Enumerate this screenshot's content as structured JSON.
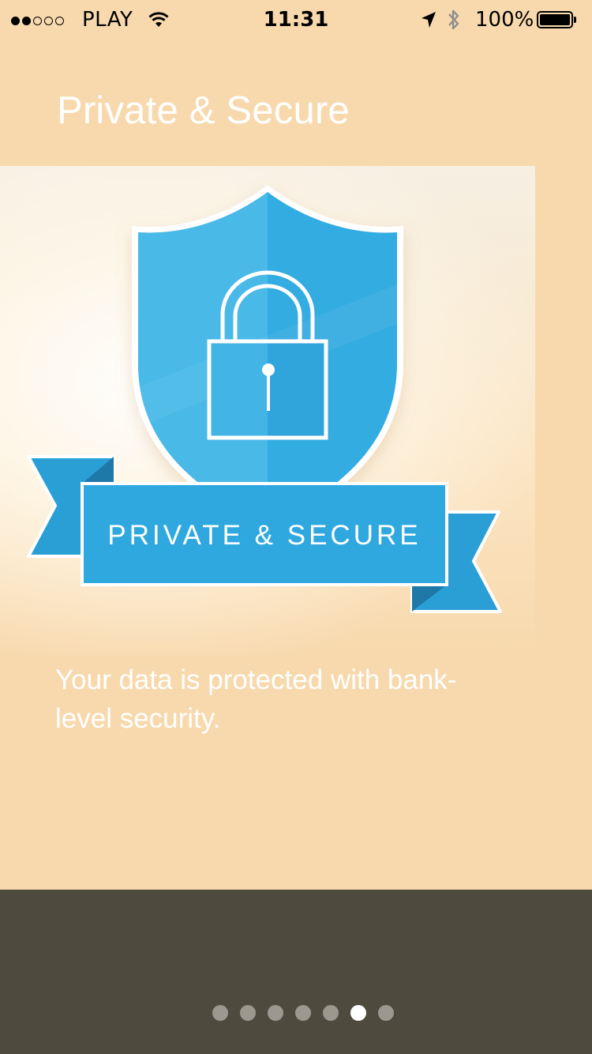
{
  "status_bar": {
    "signal_bars_on": 2,
    "signal_bars_total": 5,
    "carrier": "PLAY",
    "time": "11:31",
    "battery_percent": "100%",
    "icons": [
      "wifi-icon",
      "location-arrow-icon",
      "bluetooth-icon",
      "battery-icon"
    ]
  },
  "onboarding": {
    "title": "Private & Secure",
    "illustration": {
      "icons": [
        "shield-icon",
        "padlock-icon",
        "ribbon-banner"
      ],
      "banner_text": "PRIVATE & SECURE"
    },
    "description": "Your data is protected with bank-level security."
  },
  "pager": {
    "count": 7,
    "active_index": 5
  },
  "colors": {
    "background": "#f8d9ad",
    "shield_blue": "#2fa8df",
    "bottom_bar": "#4f4a3e",
    "dot_inactive": "#9c988f",
    "dot_active": "#ffffff"
  }
}
